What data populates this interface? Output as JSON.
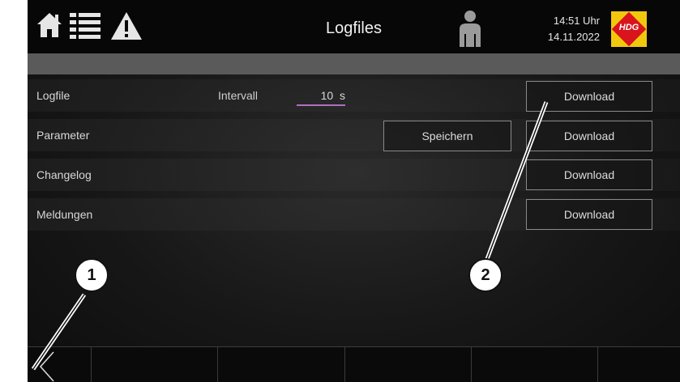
{
  "header": {
    "title": "Logfiles",
    "time": "14:51 Uhr",
    "date": "14.11.2022",
    "logo_text": "HDG",
    "icons": [
      "home-icon",
      "list-icon",
      "warning-icon",
      "user-icon"
    ]
  },
  "rows": [
    {
      "label": "Logfile",
      "interval_label": "Intervall",
      "interval_value": "10",
      "interval_unit": "s",
      "download_label": "Download"
    },
    {
      "label": "Parameter",
      "save_label": "Speichern",
      "download_label": "Download"
    },
    {
      "label": "Changelog",
      "download_label": "Download"
    },
    {
      "label": "Meldungen",
      "download_label": "Download"
    }
  ],
  "footer": {
    "back_icon": "chevron-left-icon"
  },
  "callouts": {
    "one": "1",
    "two": "2"
  },
  "colors": {
    "header_bg": "#070707",
    "subbar_bg": "#5a5a5a",
    "interval_underline": "#b06fc0",
    "logo_yellow": "#f2c80f",
    "logo_red": "#d9141c"
  }
}
